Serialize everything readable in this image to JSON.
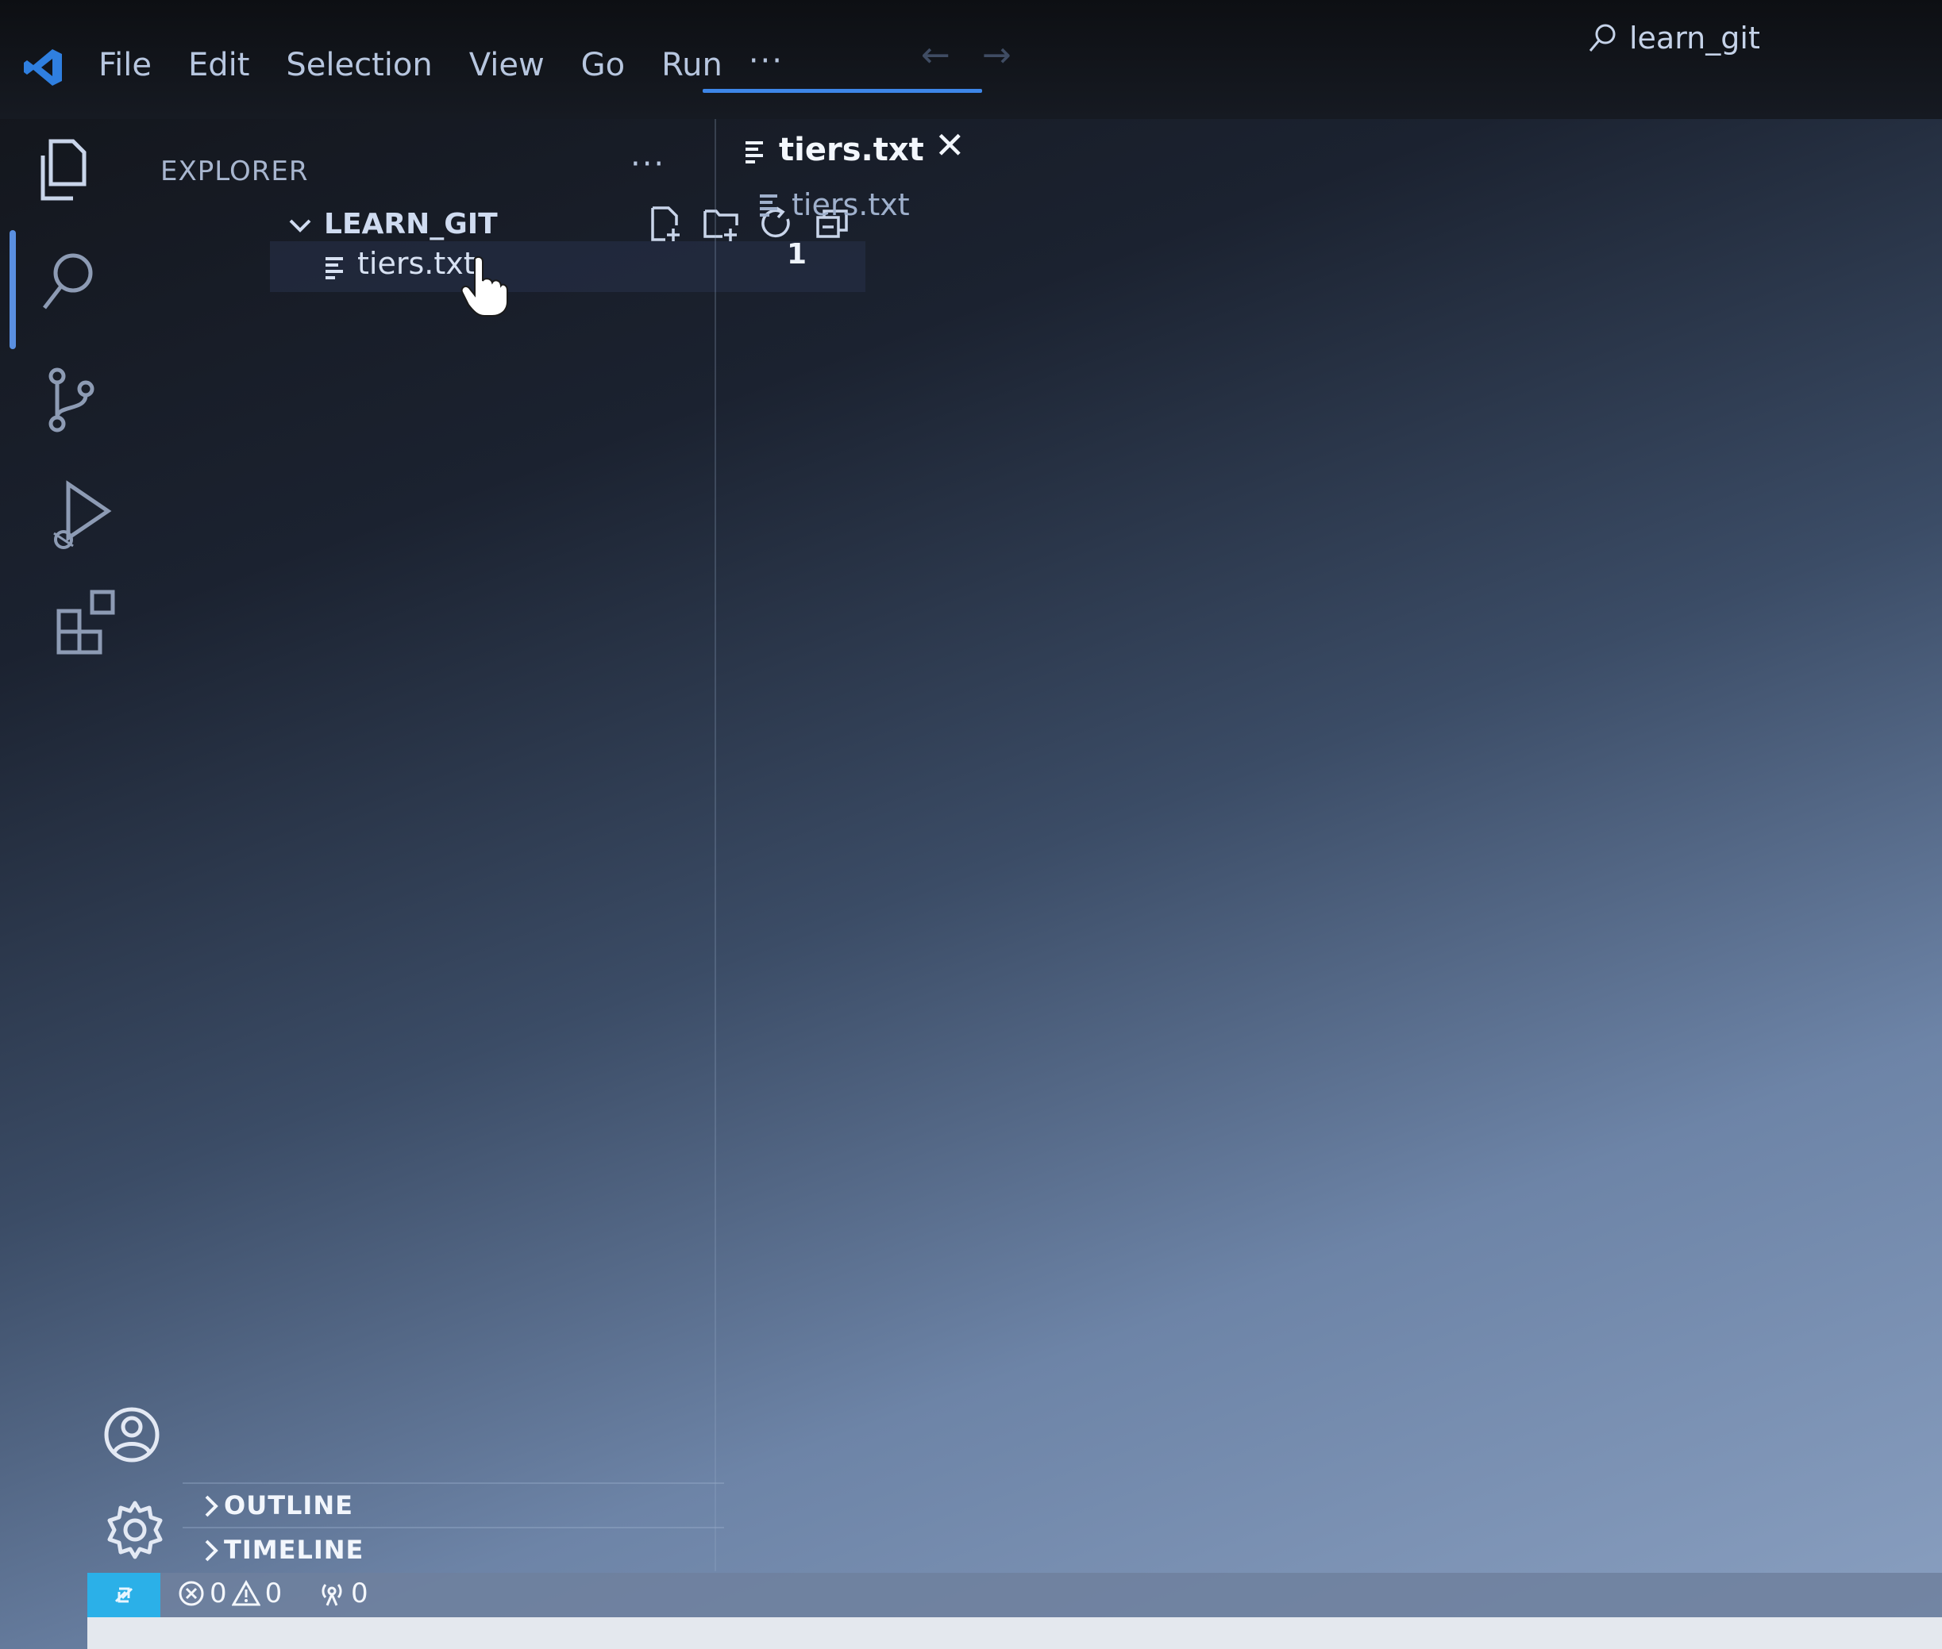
{
  "menu": {
    "items": [
      "File",
      "Edit",
      "Selection",
      "View",
      "Go",
      "Run"
    ],
    "more": "···"
  },
  "nav": {
    "back": "←",
    "forward": "→"
  },
  "command_center": {
    "text": "learn_git"
  },
  "sidebar": {
    "title": "EXPLORER",
    "more": "···",
    "folder": {
      "name": "LEARN_GIT"
    },
    "files": [
      {
        "name": "tiers.txt"
      }
    ],
    "panels": [
      {
        "title": "OUTLINE"
      },
      {
        "title": "TIMELINE"
      }
    ]
  },
  "editor": {
    "tab": {
      "label": "tiers.txt",
      "close": "✕"
    },
    "breadcrumb": "tiers.txt",
    "line_number": "1"
  },
  "status": {
    "errors": "0",
    "warnings": "0",
    "ports": "0"
  },
  "colors": {
    "accent": "#3d86e8",
    "remote": "#2bb0e8",
    "logo": "#2f7fe0"
  },
  "icons": {
    "activity": [
      "files-icon",
      "search-icon",
      "source-control-icon",
      "run-debug-icon",
      "extensions-icon",
      "account-icon",
      "settings-gear-icon"
    ],
    "folder_actions": [
      "new-file-icon",
      "new-folder-icon",
      "refresh-icon",
      "collapse-all-icon"
    ]
  }
}
